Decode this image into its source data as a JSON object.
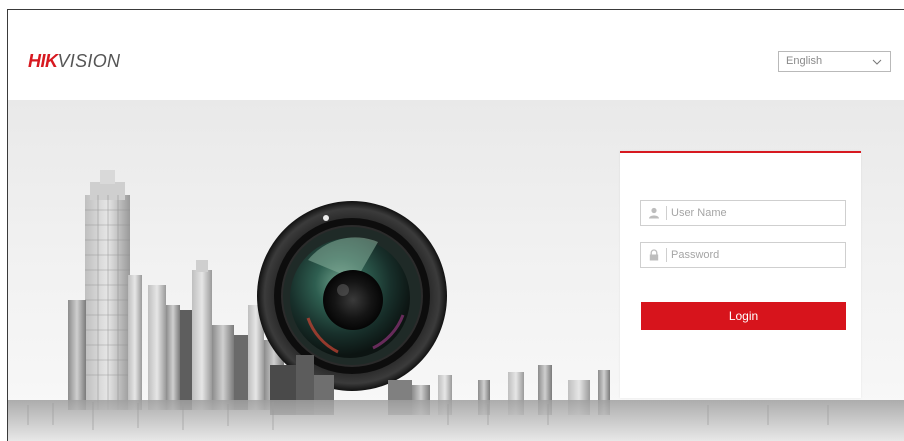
{
  "brand": {
    "logo_red": "HIK",
    "logo_grey": "VISION",
    "accent_color": "#d71920"
  },
  "language": {
    "selected": "English",
    "icon": "chevron-down-icon"
  },
  "login": {
    "username_placeholder": "User Name",
    "password_placeholder": "Password",
    "username_icon": "user-icon",
    "password_icon": "lock-icon",
    "button_label": "Login"
  },
  "banner": {
    "illustration": "city-skyline-with-camera-lens"
  }
}
